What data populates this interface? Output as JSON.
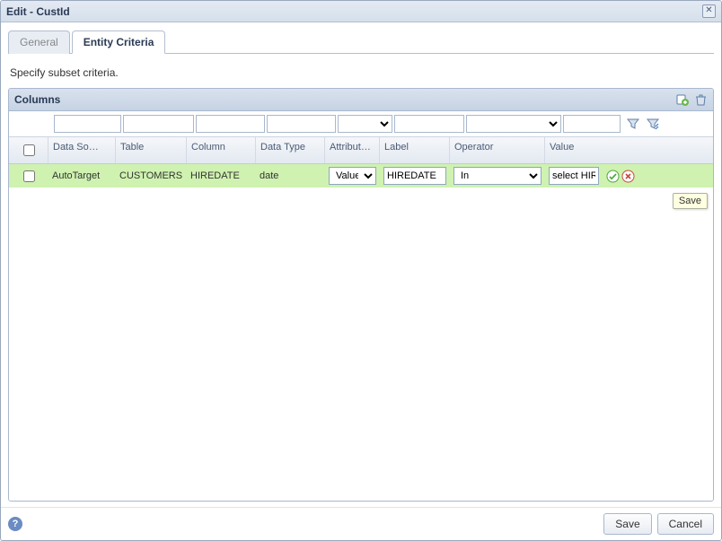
{
  "window": {
    "title": "Edit - CustId"
  },
  "tabs": {
    "general": "General",
    "entity": "Entity Criteria"
  },
  "instruction": "Specify subset criteria.",
  "panel": {
    "title": "Columns"
  },
  "headers": {
    "data_source": "Data So…",
    "table": "Table",
    "column": "Column",
    "data_type": "Data Type",
    "attribute": "Attribut…",
    "label": "Label",
    "operator": "Operator",
    "value": "Value"
  },
  "row": {
    "data_source": "AutoTarget",
    "table": "CUSTOMERS",
    "column": "HIREDATE",
    "data_type": "date",
    "attribute": "Value",
    "label": "HIREDATE",
    "operator": "In",
    "value": "select HIR"
  },
  "tooltip": "Save",
  "footer": {
    "save": "Save",
    "cancel": "Cancel"
  }
}
